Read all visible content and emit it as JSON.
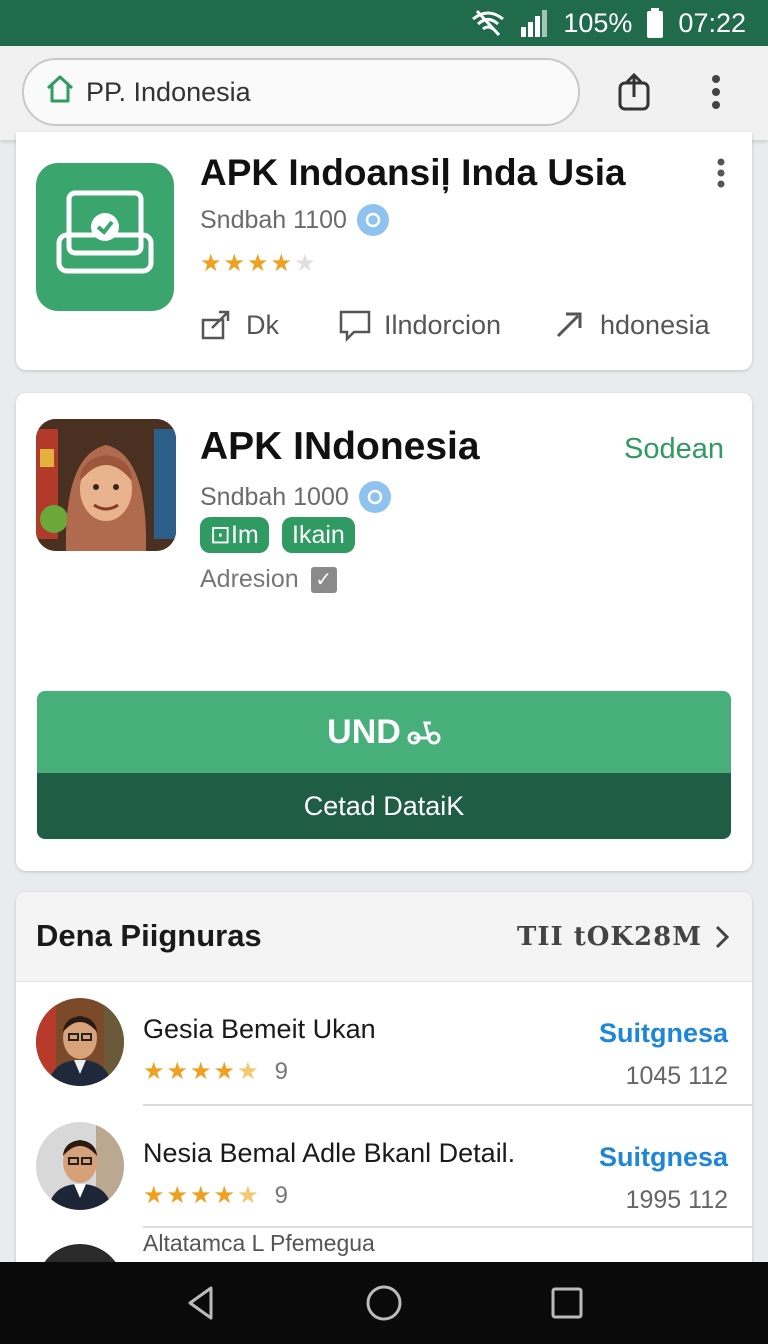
{
  "status_bar": {
    "battery": "105%",
    "time": "07:22"
  },
  "browser": {
    "url_text": "PP. Indonesia"
  },
  "app_card": {
    "title": "APK Indoansiļ Inda Usia",
    "subtitle": "Sndbah 1100",
    "rating": 4,
    "actions": [
      {
        "label": "Dk",
        "icon": "share-icon"
      },
      {
        "label": "Ilndorcion",
        "icon": "comment-icon"
      },
      {
        "label": "hdonesia",
        "icon": "forward-arrow-icon"
      }
    ]
  },
  "detail_card": {
    "title": "APK INdonesia",
    "status": "Sodean",
    "subtitle": "Sndbah 1000",
    "tags": [
      "⊡Im",
      "Ikain"
    ],
    "adresion": "Adresion",
    "cta_primary": "UND",
    "cta_secondary": "Cetad DataiK"
  },
  "reviews": {
    "title": "Dena Piignuras",
    "link": "TII tOK28M",
    "items": [
      {
        "name": "Gesia Bemeit Ukan",
        "rating": 4.5,
        "count": "9",
        "link": "Suitgnesa",
        "number": "1045 112"
      },
      {
        "name": "Nesia Bemal Adle Bkanl Detail.",
        "rating": 4.5,
        "count": "9",
        "link": "Suitgnesa",
        "number": "1995 112"
      }
    ],
    "partial_row": "Altatamca L Pfemegua"
  },
  "colors": {
    "brand_green": "#2f9a62",
    "status_bar": "#1f6b4b",
    "link_blue": "#1d86d8",
    "star": "#f0a020"
  }
}
